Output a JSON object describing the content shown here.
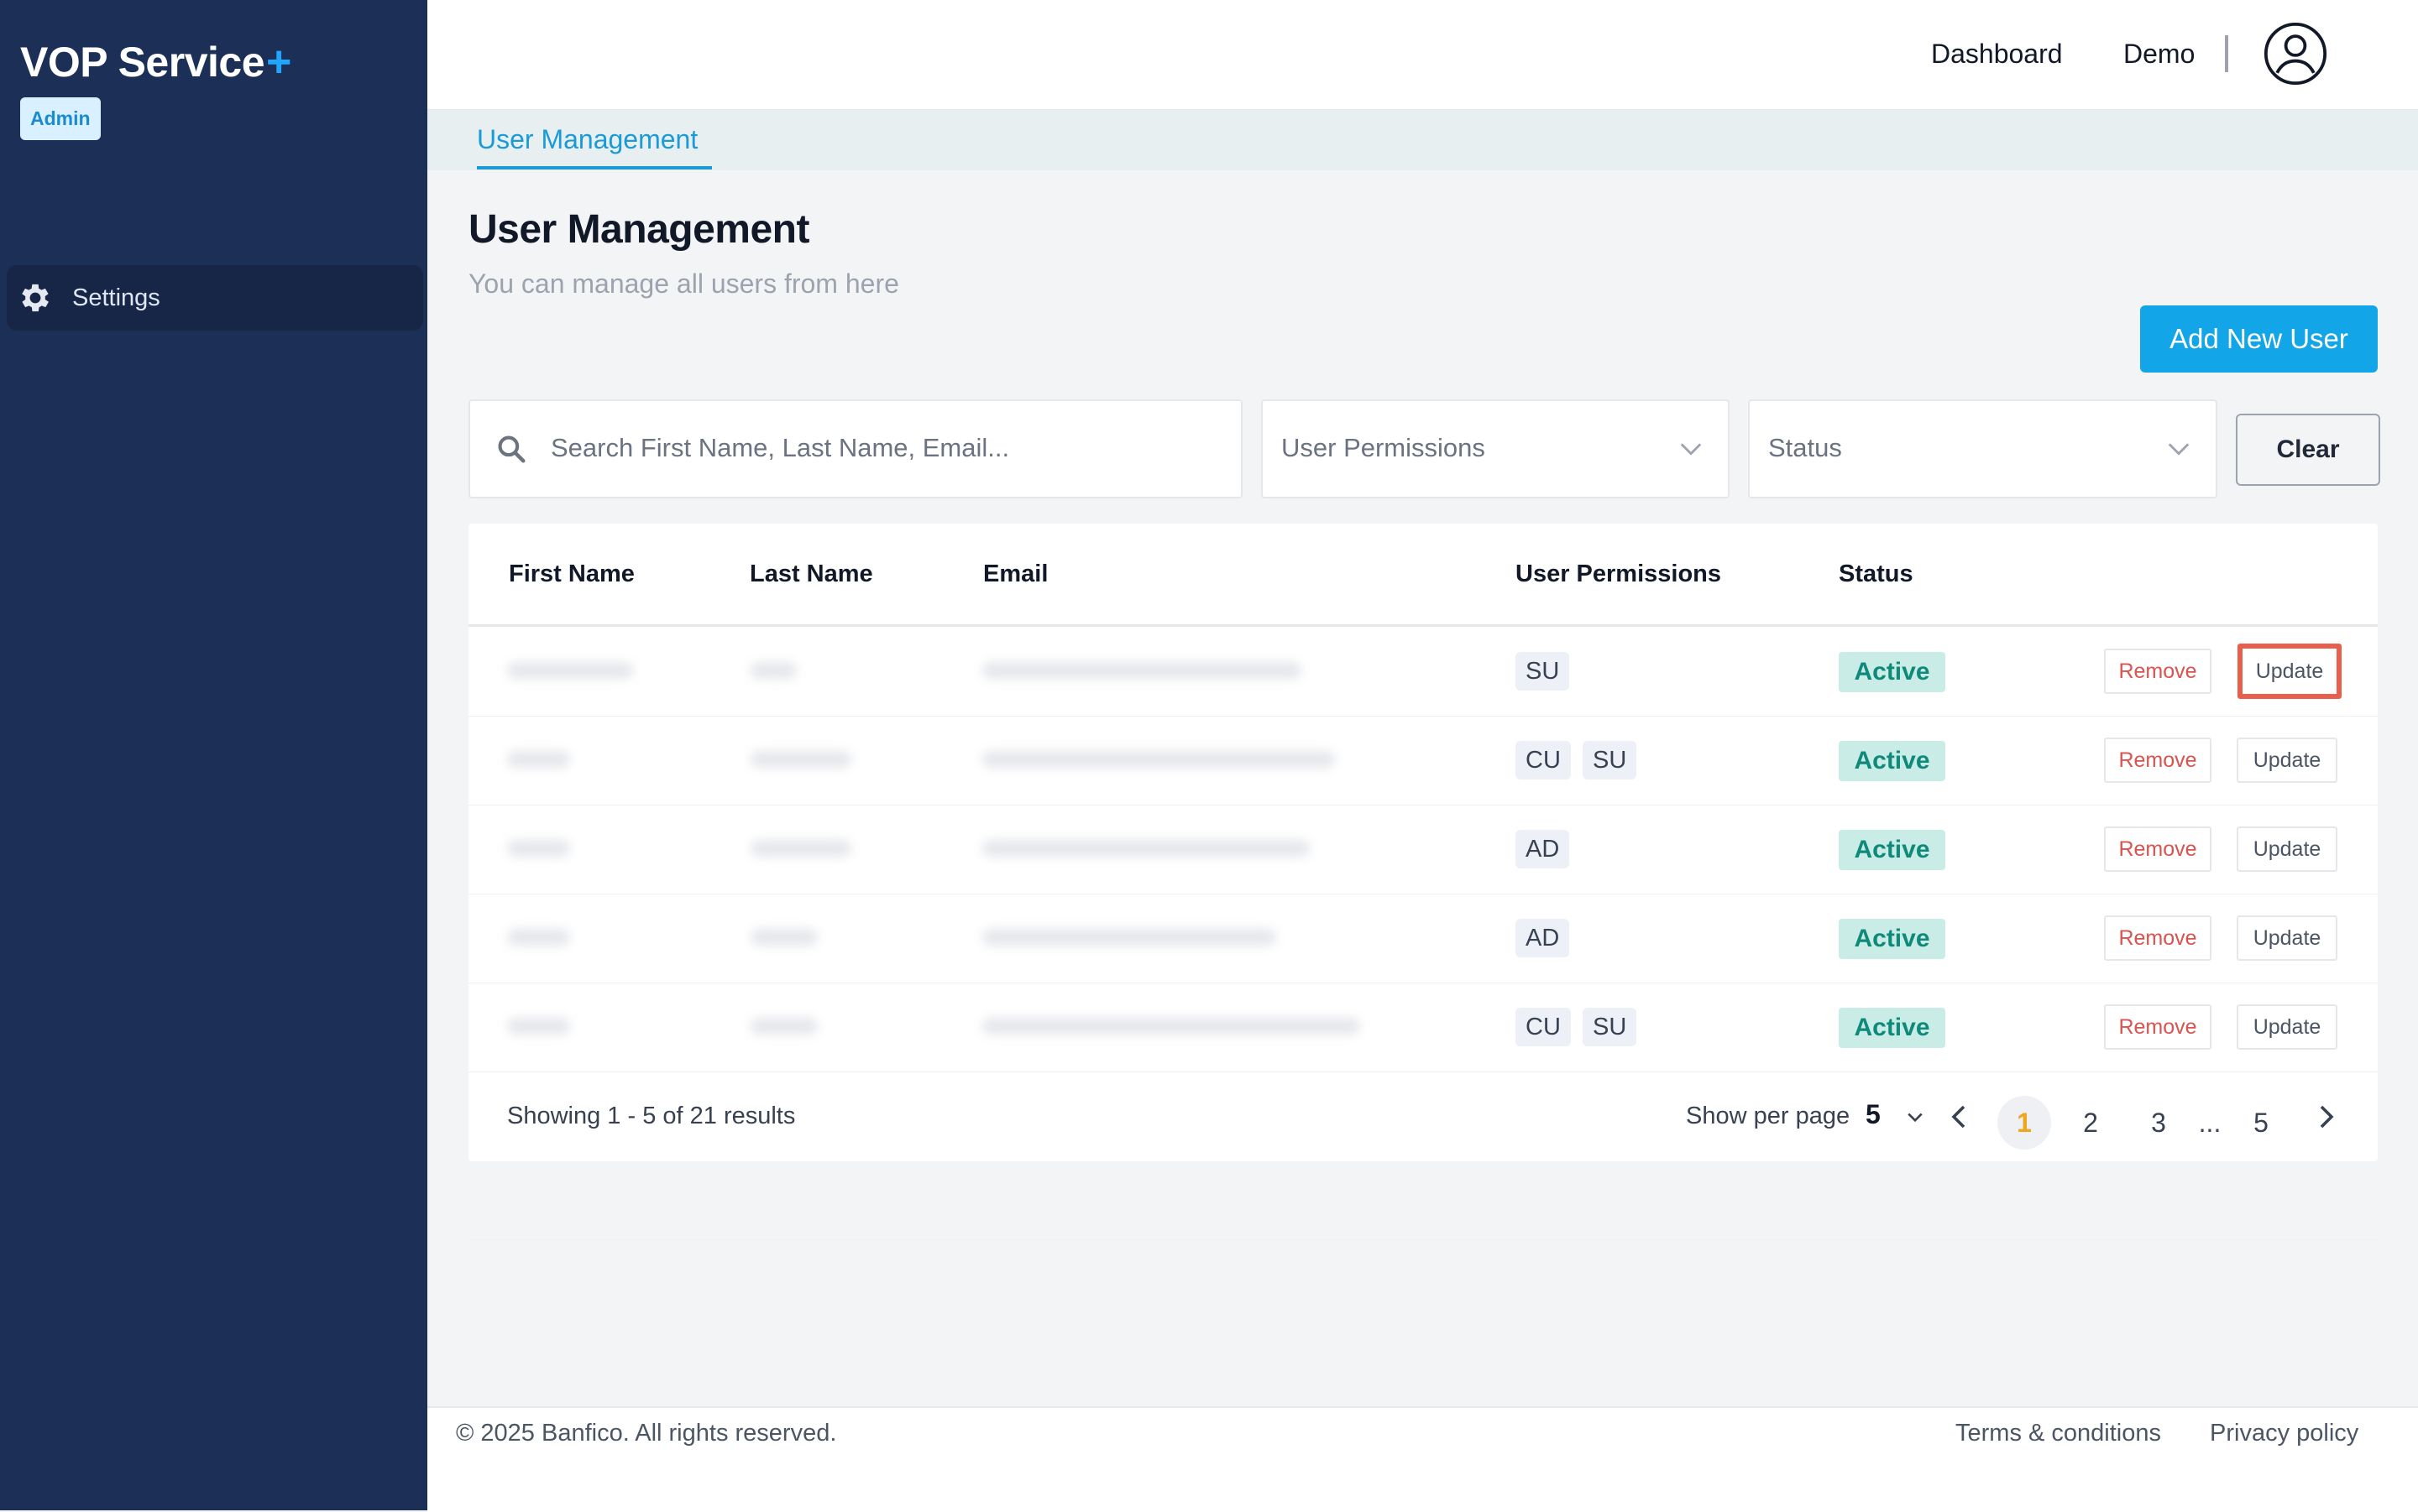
{
  "sidebar": {
    "brand": "VOP Service",
    "brand_plus": "+",
    "badge": "Admin",
    "items": [
      {
        "label": "Settings",
        "icon": "gear-icon"
      }
    ]
  },
  "header": {
    "nav": [
      {
        "label": "Dashboard"
      },
      {
        "label": "Demo"
      }
    ],
    "avatar_icon": "user-circle-icon"
  },
  "tabs": [
    {
      "label": "User Management",
      "active": true
    }
  ],
  "page": {
    "title": "User Management",
    "subtitle": "You can manage all users from here",
    "add_button": "Add New User"
  },
  "filters": {
    "search_placeholder": "Search First Name, Last Name, Email...",
    "permissions_placeholder": "User Permissions",
    "status_placeholder": "Status",
    "clear_label": "Clear"
  },
  "table": {
    "columns": [
      "First Name",
      "Last Name",
      "Email",
      "User Permissions",
      "Status"
    ],
    "rows": [
      {
        "permissions": [
          "SU"
        ],
        "status": "Active",
        "remove": "Remove",
        "update": "Update"
      },
      {
        "permissions": [
          "CU",
          "SU"
        ],
        "status": "Active",
        "remove": "Remove",
        "update": "Update"
      },
      {
        "permissions": [
          "AD"
        ],
        "status": "Active",
        "remove": "Remove",
        "update": "Update"
      },
      {
        "permissions": [
          "AD"
        ],
        "status": "Active",
        "remove": "Remove",
        "update": "Update"
      },
      {
        "permissions": [
          "CU",
          "SU"
        ],
        "status": "Active",
        "remove": "Remove",
        "update": "Update"
      }
    ]
  },
  "pagination": {
    "showing": "Showing 1 - 5 of 21 results",
    "per_page_label": "Show per page",
    "per_page_value": "5",
    "pages": [
      "1",
      "2",
      "3",
      "...",
      "5"
    ],
    "current": "1"
  },
  "footer": {
    "copyright": "© 2025 Banfico. All rights reserved.",
    "terms": "Terms & conditions",
    "privacy": "Privacy policy"
  },
  "colors": {
    "sidebar_bg": "#1c2f57",
    "accent": "#12a5e8",
    "active_status": "#0f8a7a",
    "remove_text": "#d9534f",
    "highlight_border": "#e8604c"
  }
}
